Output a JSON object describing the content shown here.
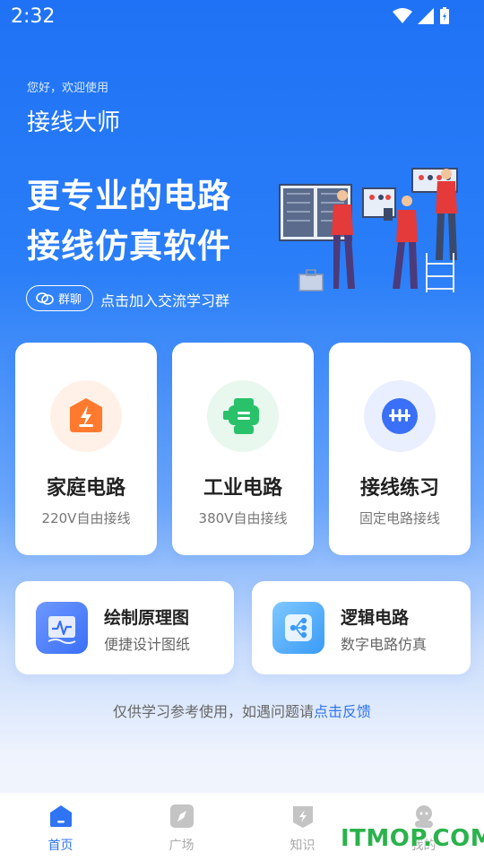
{
  "status_bar": {
    "time": "2:32"
  },
  "header": {
    "greeting": "您好，欢迎使用",
    "app_title": "接线大师"
  },
  "hero": {
    "line1": "更专业的电路",
    "line2": "接线仿真软件"
  },
  "group": {
    "pill_label": "群聊",
    "hint": "点击加入交流学习群"
  },
  "cards": [
    {
      "title": "家庭电路",
      "subtitle": "220V自由接线",
      "icon": "home-bolt-icon",
      "color": "#ff7a2e"
    },
    {
      "title": "工业电路",
      "subtitle": "380V自由接线",
      "icon": "industrial-machine-icon",
      "color": "#29c16a"
    },
    {
      "title": "接线练习",
      "subtitle": "固定电路接线",
      "icon": "wiring-practice-icon",
      "color": "#3a6ff7"
    }
  ],
  "wide_cards": [
    {
      "title": "绘制原理图",
      "subtitle": "便捷设计图纸",
      "icon": "schematic-icon"
    },
    {
      "title": "逻辑电路",
      "subtitle": "数字电路仿真",
      "icon": "logic-circuit-icon"
    }
  ],
  "disclaimer": {
    "text": "仅供学习参考使用，如遇问题请",
    "link": "点击反馈"
  },
  "nav": [
    {
      "label": "首页",
      "icon": "home-icon",
      "active": true
    },
    {
      "label": "广场",
      "icon": "compass-icon",
      "active": false
    },
    {
      "label": "知识",
      "icon": "knowledge-icon",
      "active": false
    },
    {
      "label": "我的",
      "icon": "profile-icon",
      "active": false
    }
  ],
  "watermark": "ITMOP.COM",
  "colors": {
    "primary": "#2f74f2",
    "background_top": "#1f72f5"
  }
}
